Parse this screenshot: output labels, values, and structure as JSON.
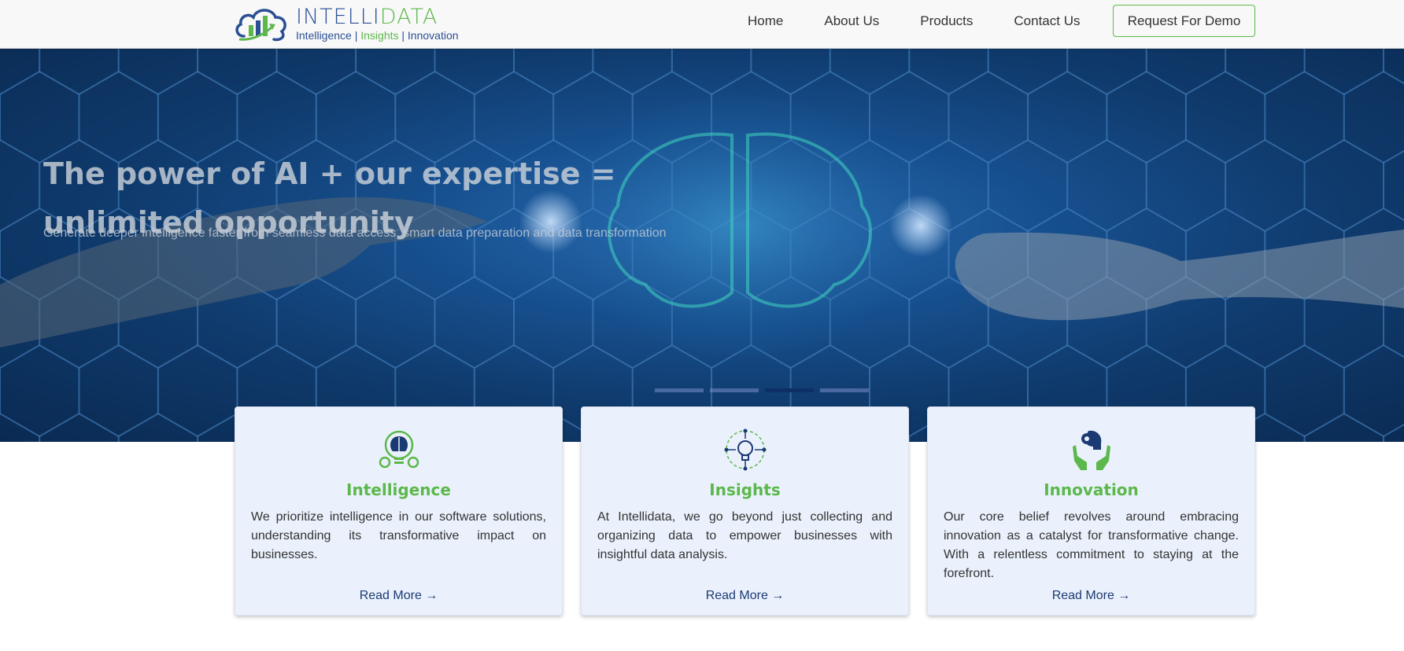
{
  "colors": {
    "brand_blue": "#2b4f94",
    "brand_green": "#5cb84b",
    "hero_dark": "#0a2a52",
    "card_bg": "#eaf1fc"
  },
  "logo": {
    "word_part1": "INTELLI",
    "word_part2": "DATA",
    "tag_intelligence": "Intelligence",
    "tag_sep": "|",
    "tag_insights": "Insights",
    "tag_innovation": "Innovation"
  },
  "nav": {
    "home": "Home",
    "about": "About Us",
    "products": "Products",
    "contact": "Contact Us",
    "demo": "Request For Demo"
  },
  "hero": {
    "title": "The power of AI + our expertise = unlimited opportunity",
    "subtitle": "Generate deeper intelligence faster from seamless data access, smart data preparation and data transformation",
    "slides": 4,
    "active_slide": 3
  },
  "cards": [
    {
      "icon": "brain-bulb-icon",
      "title": "Intelligence",
      "text": "We prioritize intelligence in our software solutions, understanding its transformative impact on businesses.",
      "link": "Read More"
    },
    {
      "icon": "lightbulb-network-icon",
      "title": "Insights",
      "text": "At Intellidata, we go beyond just collecting and organizing data to empower businesses with insightful data analysis.",
      "link": "Read More"
    },
    {
      "icon": "hands-head-gear-icon",
      "title": "Innovation",
      "text": "Our core belief revolves around embracing innovation as a catalyst for transformative change. With a relentless commitment to staying at the forefront.",
      "link": "Read More"
    }
  ],
  "arrow_glyph": "→"
}
